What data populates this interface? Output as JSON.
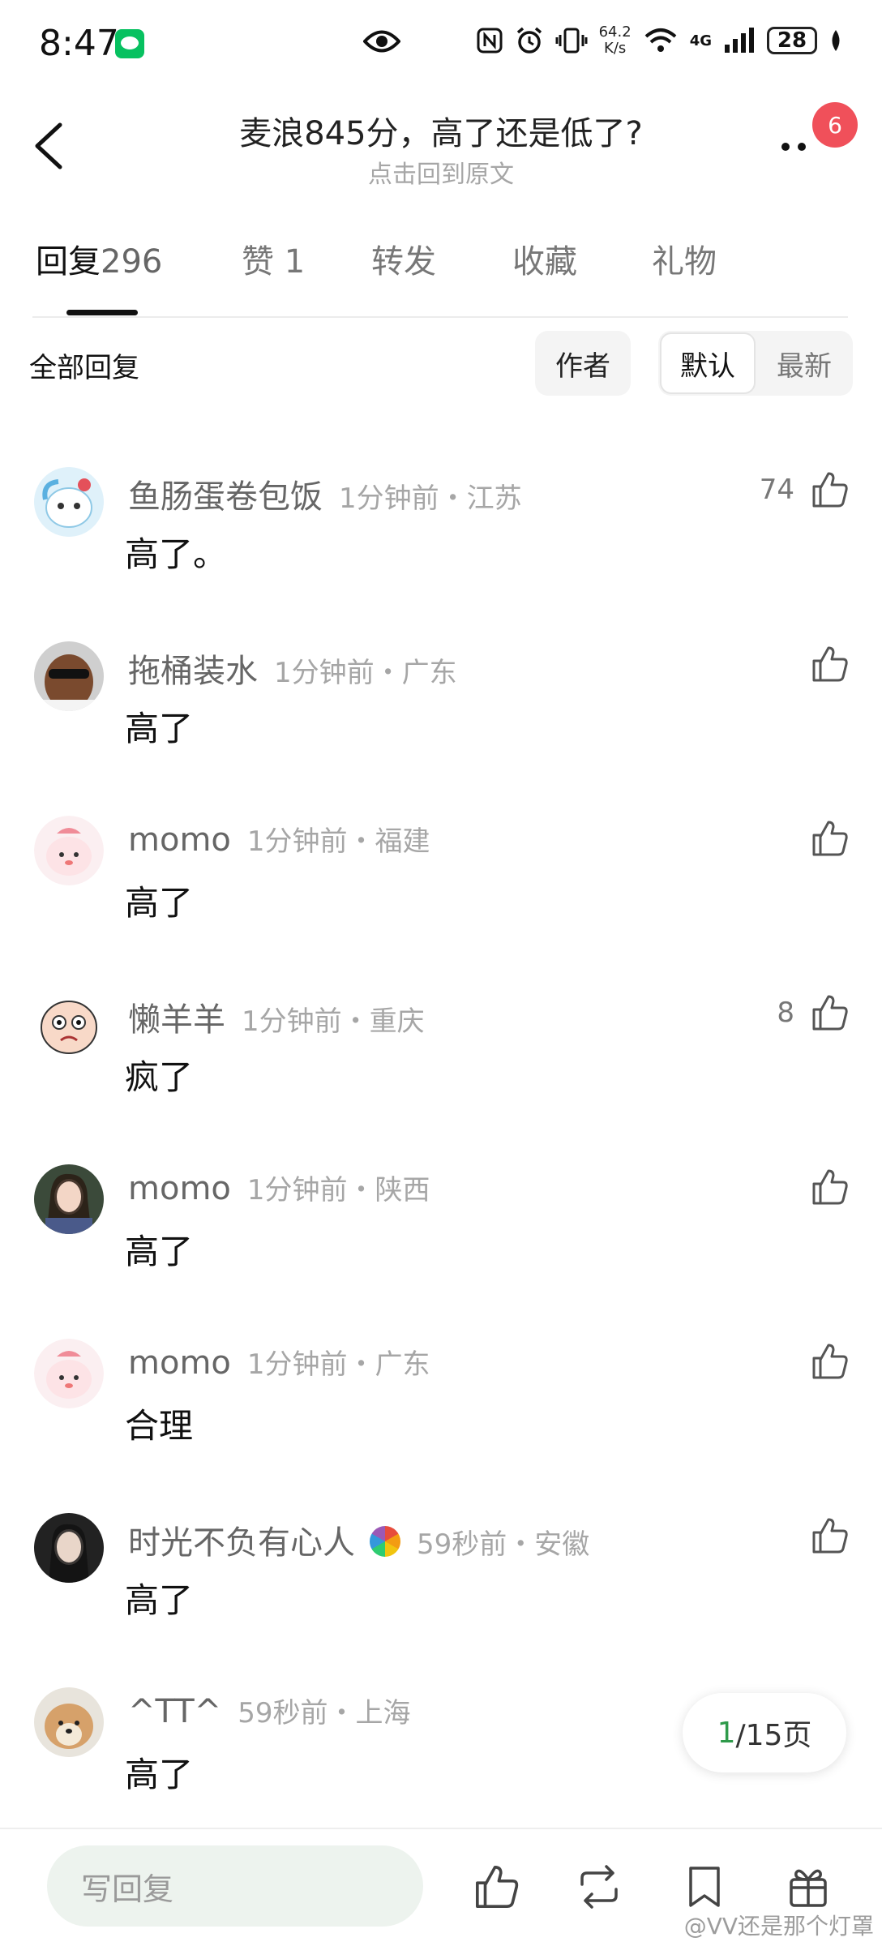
{
  "status_bar": {
    "time": "8:47",
    "network_speed": "64.2",
    "network_unit": "K/s",
    "network_type": "4G",
    "battery": "28"
  },
  "header": {
    "title": "麦浪845分，高了还是低了?",
    "subtitle": "点击回到原文",
    "notification_count": "6"
  },
  "tabs": [
    {
      "label": "回复",
      "count": "296"
    },
    {
      "label": "赞",
      "count": "1"
    },
    {
      "label": "转发",
      "count": ""
    },
    {
      "label": "收藏",
      "count": ""
    },
    {
      "label": "礼物",
      "count": ""
    }
  ],
  "filter": {
    "all_label": "全部回复",
    "author_label": "作者",
    "sort_default": "默认",
    "sort_latest": "最新"
  },
  "comments": [
    {
      "name": "鱼肠蛋卷包饭",
      "meta": "1分钟前・江苏",
      "content": "高了。",
      "likes": "74"
    },
    {
      "name": "拖桶装水",
      "meta": "1分钟前・广东",
      "content": "高了",
      "likes": ""
    },
    {
      "name": "momo",
      "meta": "1分钟前・福建",
      "content": "高了",
      "likes": ""
    },
    {
      "name": "懒羊羊",
      "meta": "1分钟前・重庆",
      "content": "疯了",
      "likes": "8"
    },
    {
      "name": "momo",
      "meta": "1分钟前・陕西",
      "content": "高了",
      "likes": ""
    },
    {
      "name": "momo",
      "meta": "1分钟前・广东",
      "content": "合理",
      "likes": ""
    },
    {
      "name": "时光不负有心人",
      "meta": "59秒前・安徽",
      "content": "高了",
      "likes": ""
    },
    {
      "name": "^TT^",
      "meta": "59秒前・上海",
      "content": "高了",
      "likes": ""
    }
  ],
  "pagination": {
    "current": "1",
    "total_text": "/15页"
  },
  "bottom_bar": {
    "reply_placeholder": "写回复",
    "watermark": "@VV还是那个灯罩"
  },
  "colors": {
    "accent_green": "#2e9a4a",
    "badge_red": "#f0505a",
    "input_bg": "#edf3ee"
  }
}
